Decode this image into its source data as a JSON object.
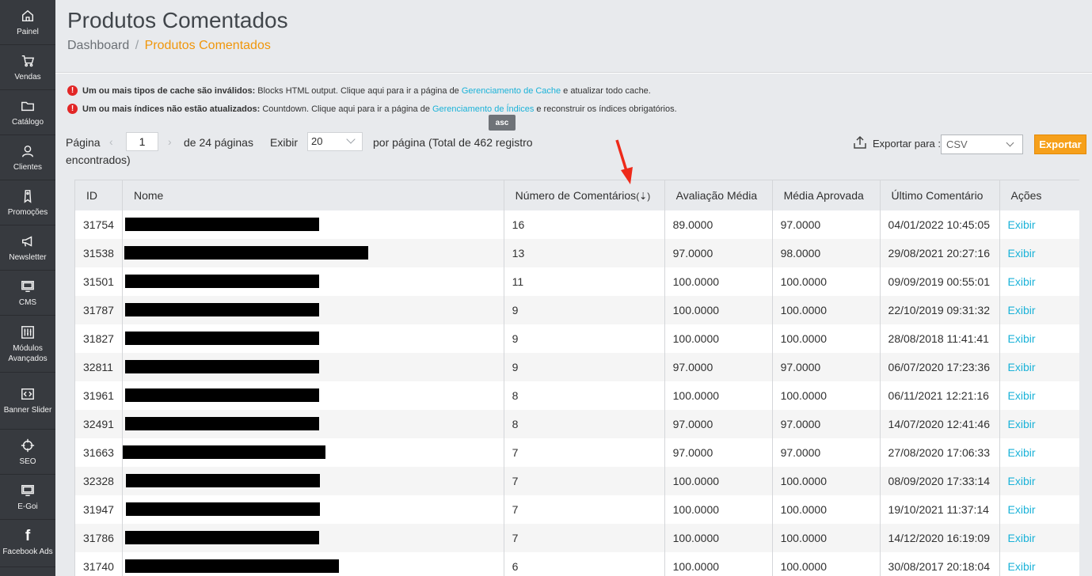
{
  "sidebar": {
    "items": [
      {
        "label": "Painel",
        "icon": "home-icon"
      },
      {
        "label": "Vendas",
        "icon": "cart-icon"
      },
      {
        "label": "Catálogo",
        "icon": "folder-icon"
      },
      {
        "label": "Clientes",
        "icon": "user-icon"
      },
      {
        "label": "Promoções",
        "icon": "tag-icon"
      },
      {
        "label": "Newsletter",
        "icon": "megaphone-icon"
      },
      {
        "label": "CMS",
        "icon": "monitor-icon"
      },
      {
        "label": "Módulos Avançados",
        "icon": "sliders-icon"
      },
      {
        "label": "Banner Slider",
        "icon": "code-icon"
      },
      {
        "label": "SEO",
        "icon": "crosshair-icon"
      },
      {
        "label": "E-Goi",
        "icon": "monitor-icon"
      },
      {
        "label": "Facebook Ads",
        "icon": "facebook-icon"
      }
    ]
  },
  "header": {
    "title": "Produtos Comentados",
    "breadcrumb": {
      "root": "Dashboard",
      "separator": "/",
      "current": "Produtos Comentados"
    }
  },
  "messages": [
    {
      "bold": "Um ou mais tipos de cache são inválidos:",
      "text": "Blocks HTML output. Clique aqui para ir a página de",
      "link": "Gerenciamento de Cache",
      "tail": "e atualizar todo cache."
    },
    {
      "bold": "Um ou mais índices não estão atualizados:",
      "text": "Countdown. Clique aqui para ir a página de",
      "link": "Gerenciamento de Índices",
      "tail": "e reconstruir os índices obrigatórios."
    }
  ],
  "tooltip": "asc",
  "pager": {
    "page_label": "Página",
    "page_value": "1",
    "of_pages": "de 24 páginas",
    "show_label": "Exibir",
    "per_page": "20",
    "per_page_text": "por página (Total de 462 registro",
    "found_text": "encontrados)"
  },
  "export": {
    "label": "Exportar para :",
    "format": "CSV",
    "button": "Exportar"
  },
  "table": {
    "columns": [
      "ID",
      "Nome",
      "Número de Comentários",
      "Avaliação Média",
      "Média Aprovada",
      "Último Comentário",
      "Ações"
    ],
    "sort_indicator": "(⇣)",
    "action_label": "Exibir",
    "rows": [
      {
        "id": "31754",
        "comments": "16",
        "avg": "89.0000",
        "approved": "97.0000",
        "last": "04/01/2022 10:45:05"
      },
      {
        "id": "31538",
        "comments": "13",
        "avg": "97.0000",
        "approved": "98.0000",
        "last": "29/08/2021 20:27:16"
      },
      {
        "id": "31501",
        "comments": "11",
        "avg": "100.0000",
        "approved": "100.0000",
        "last": "09/09/2019 00:55:01"
      },
      {
        "id": "31787",
        "comments": "9",
        "avg": "100.0000",
        "approved": "100.0000",
        "last": "22/10/2019 09:31:32"
      },
      {
        "id": "31827",
        "comments": "9",
        "avg": "100.0000",
        "approved": "100.0000",
        "last": "28/08/2018 11:41:41"
      },
      {
        "id": "32811",
        "comments": "9",
        "avg": "97.0000",
        "approved": "97.0000",
        "last": "06/07/2020 17:23:36"
      },
      {
        "id": "31961",
        "comments": "8",
        "avg": "100.0000",
        "approved": "100.0000",
        "last": "06/11/2021 12:21:16"
      },
      {
        "id": "32491",
        "comments": "8",
        "avg": "97.0000",
        "approved": "97.0000",
        "last": "14/07/2020 12:41:46"
      },
      {
        "id": "31663",
        "comments": "7",
        "avg": "97.0000",
        "approved": "97.0000",
        "last": "27/08/2020 17:06:33"
      },
      {
        "id": "32328",
        "comments": "7",
        "avg": "100.0000",
        "approved": "100.0000",
        "last": "08/09/2020 17:33:14"
      },
      {
        "id": "31947",
        "comments": "7",
        "avg": "100.0000",
        "approved": "100.0000",
        "last": "19/10/2021 11:37:14"
      },
      {
        "id": "31786",
        "comments": "7",
        "avg": "100.0000",
        "approved": "100.0000",
        "last": "14/12/2020 16:19:09"
      },
      {
        "id": "31740",
        "comments": "6",
        "avg": "100.0000",
        "approved": "100.0000",
        "last": "30/08/2017 20:18:04"
      }
    ]
  }
}
